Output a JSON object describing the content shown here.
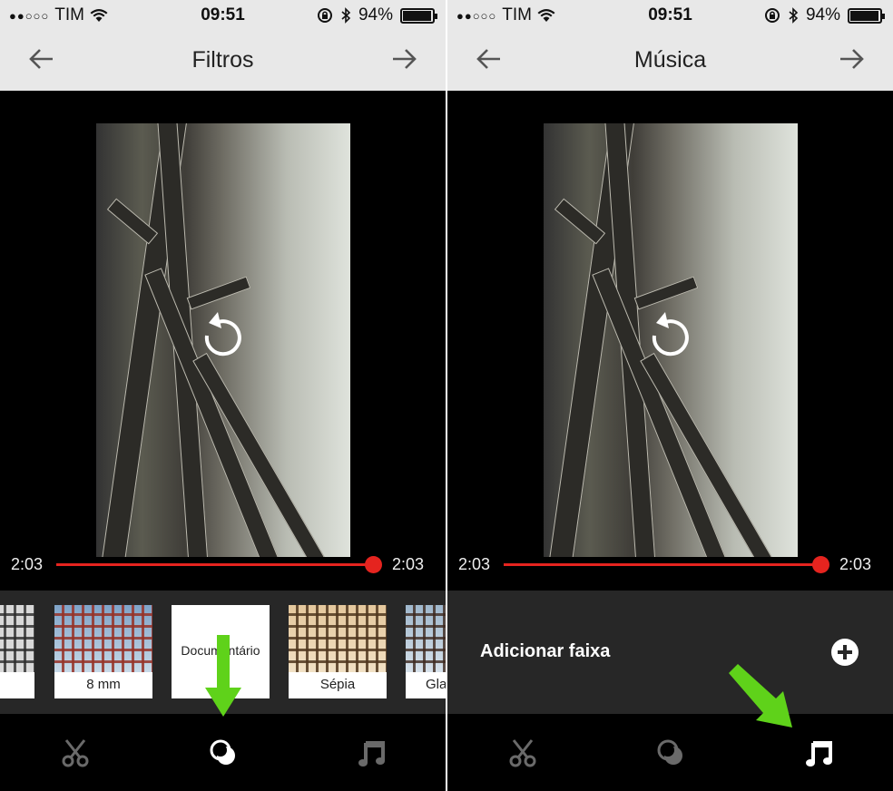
{
  "status": {
    "carrier": "TIM",
    "time": "09:51",
    "battery": "94%",
    "battery_level": 0.94,
    "icons": [
      "signal-dots-icon",
      "wifi-icon",
      "orientation-lock-icon",
      "bluetooth-icon",
      "battery-icon"
    ]
  },
  "screens": {
    "filters": {
      "title": "Filtros",
      "time_start": "2:03",
      "time_end": "2:03",
      "filters": [
        "nza",
        "8 mm",
        "Documentário",
        "Sépia",
        "Gla"
      ],
      "active_tab": "filters-icon"
    },
    "music": {
      "title": "Música",
      "time_start": "2:03",
      "time_end": "2:03",
      "add_track_label": "Adicionar faixa",
      "active_tab": "music-note-icon"
    }
  },
  "tabs": [
    "scissors-icon",
    "filters-icon",
    "music-note-icon"
  ],
  "colors": {
    "accent_red": "#e5241f",
    "highlight_green": "#5fd21a",
    "navbar_bg": "#e8e8e8",
    "tray_bg": "#272727"
  }
}
